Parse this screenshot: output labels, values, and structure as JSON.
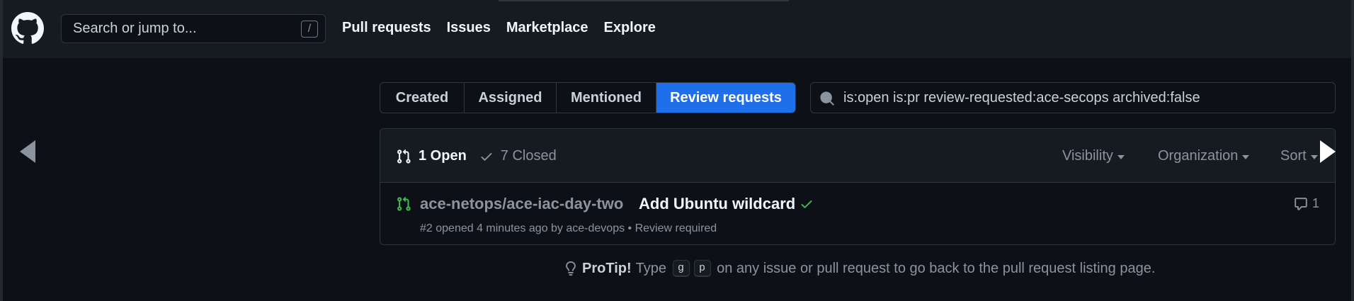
{
  "header": {
    "search_placeholder": "Search or jump to...",
    "search_shortcut": "/",
    "nav": [
      "Pull requests",
      "Issues",
      "Marketplace",
      "Explore"
    ]
  },
  "tabs": [
    {
      "label": "Created",
      "active": false
    },
    {
      "label": "Assigned",
      "active": false
    },
    {
      "label": "Mentioned",
      "active": false
    },
    {
      "label": "Review requests",
      "active": true
    }
  ],
  "filter_query": "is:open is:pr review-requested:ace-secops archived:false",
  "states": {
    "open": "1 Open",
    "closed": "7 Closed"
  },
  "dropdowns": [
    "Visibility",
    "Organization",
    "Sort"
  ],
  "pull_requests": [
    {
      "repo": "ace-netops/ace-iac-day-two",
      "title": "Add Ubuntu wildcard",
      "meta_prefix": "#2 opened 4 minutes ago by ",
      "author": "ace-devops",
      "status": "Review required",
      "comments": "1"
    }
  ],
  "protip": {
    "label": "ProTip!",
    "before": "Type",
    "keys": [
      "g",
      "p"
    ],
    "after": "on any issue or pull request to go back to the pull request listing page."
  },
  "colors": {
    "accent": "#1f6feb",
    "open": "#3fb950",
    "bg": "#0d1117",
    "header": "#161b22"
  }
}
